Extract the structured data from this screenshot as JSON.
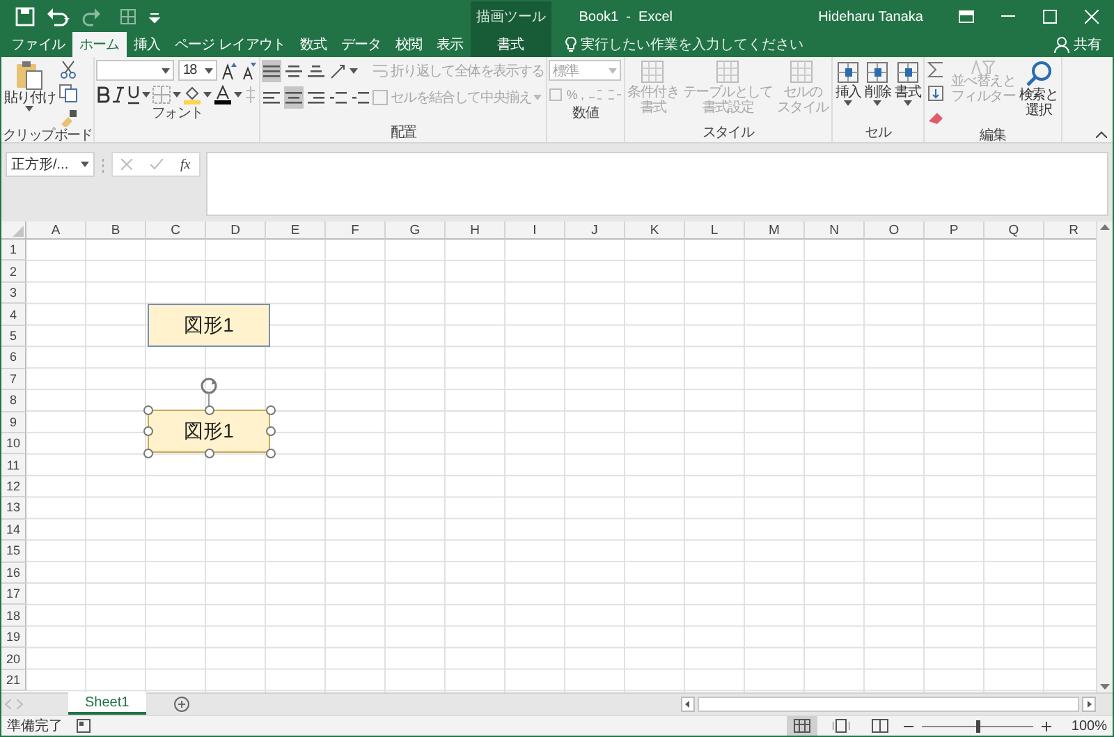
{
  "window": {
    "title": "Book1  -  Excel",
    "user": "Hideharu Tanaka"
  },
  "context_group": {
    "label": "描画ツール"
  },
  "tabs": [
    {
      "label": "ファイル",
      "selected": false,
      "kind": "file"
    },
    {
      "label": "ホーム",
      "selected": true,
      "kind": "normal"
    },
    {
      "label": "挿入",
      "selected": false,
      "kind": "normal"
    },
    {
      "label": "ページ レイアウト",
      "selected": false,
      "kind": "normal"
    },
    {
      "label": "数式",
      "selected": false,
      "kind": "normal"
    },
    {
      "label": "データ",
      "selected": false,
      "kind": "normal"
    },
    {
      "label": "校閲",
      "selected": false,
      "kind": "normal"
    },
    {
      "label": "表示",
      "selected": false,
      "kind": "normal"
    },
    {
      "label": "書式",
      "selected": false,
      "kind": "contextual"
    }
  ],
  "tell_me": {
    "placeholder": "実行したい作業を入力してください"
  },
  "share": {
    "label": "共有"
  },
  "ribbon": {
    "clipboard": {
      "label": "クリップボード",
      "paste": "貼り付け"
    },
    "font": {
      "label": "フォント",
      "size": "18"
    },
    "alignment": {
      "label": "配置",
      "wrap": {
        "label": "折り返して全体を表示する",
        "disabled": true
      },
      "merge": {
        "label": "セルを結合して中央揃え",
        "disabled": true
      }
    },
    "number": {
      "label": "数値",
      "format": "標準",
      "percent": "%",
      "comma": ","
    },
    "styles": {
      "label": "スタイル",
      "buttons": [
        {
          "lines": [
            "条件付き",
            "書式"
          ],
          "disabled": true
        },
        {
          "lines": [
            "テーブルとして",
            "書式設定"
          ],
          "disabled": true
        },
        {
          "lines": [
            "セルの",
            "スタイル"
          ],
          "disabled": true
        }
      ]
    },
    "cells": {
      "label": "セル",
      "buttons": [
        {
          "label": "挿入",
          "disabled": false
        },
        {
          "label": "削除",
          "disabled": false
        },
        {
          "label": "書式",
          "disabled": false
        }
      ]
    },
    "editing": {
      "label": "編集",
      "sort": {
        "lines": [
          "並べ替えと",
          "フィルター"
        ],
        "disabled": true
      },
      "find": {
        "lines": [
          "検索と",
          "選択"
        ],
        "disabled": false
      }
    }
  },
  "formula_bar": {
    "name_box": "正方形/...",
    "function_label": "fx"
  },
  "columns": [
    "A",
    "B",
    "C",
    "D",
    "E",
    "F",
    "G",
    "H",
    "I",
    "J",
    "K",
    "L",
    "M",
    "N",
    "O",
    "P",
    "Q",
    "R"
  ],
  "rows": [
    "1",
    "2",
    "3",
    "4",
    "5",
    "6",
    "7",
    "8",
    "9",
    "10",
    "11",
    "12",
    "13",
    "14",
    "15",
    "16",
    "17",
    "18",
    "19",
    "20",
    "21"
  ],
  "shapes": [
    {
      "text": "図形1",
      "selected": false
    },
    {
      "text": "図形1",
      "selected": true
    }
  ],
  "sheets": [
    {
      "label": "Sheet1",
      "selected": true
    }
  ],
  "status_bar": {
    "status": "準備完了",
    "views": [
      {
        "selected": true,
        "kind": "normal"
      },
      {
        "selected": false,
        "kind": "page_layout"
      },
      {
        "selected": false,
        "kind": "page_break"
      }
    ],
    "zoom": {
      "level": 0.5,
      "reading": "100%"
    }
  }
}
